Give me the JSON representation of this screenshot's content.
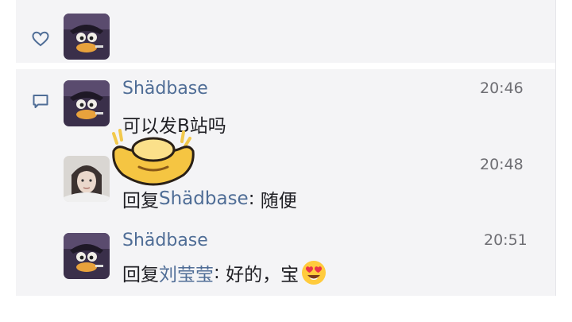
{
  "comments": [
    {
      "username": "Shädbase",
      "time": "20:46",
      "text": "可以发B站吗"
    },
    {
      "time": "20:48",
      "reply_prefix": "回复",
      "mention": "Shädbase",
      "sep": ": ",
      "text": "随便"
    },
    {
      "username": "Shädbase",
      "time": "20:51",
      "reply_prefix": "回复",
      "mention": "刘莹莹",
      "sep": ": ",
      "text": "好的，宝"
    }
  ],
  "icons": {
    "like": "heart-outline-icon",
    "comment": "comment-bubble-icon",
    "emoji": "heart-eyes-emoji",
    "overlay": "gold-ingot-sticker"
  },
  "colors": {
    "mention": "#4f6d96",
    "background": "#f4f4f6",
    "time": "#6e6e73"
  }
}
